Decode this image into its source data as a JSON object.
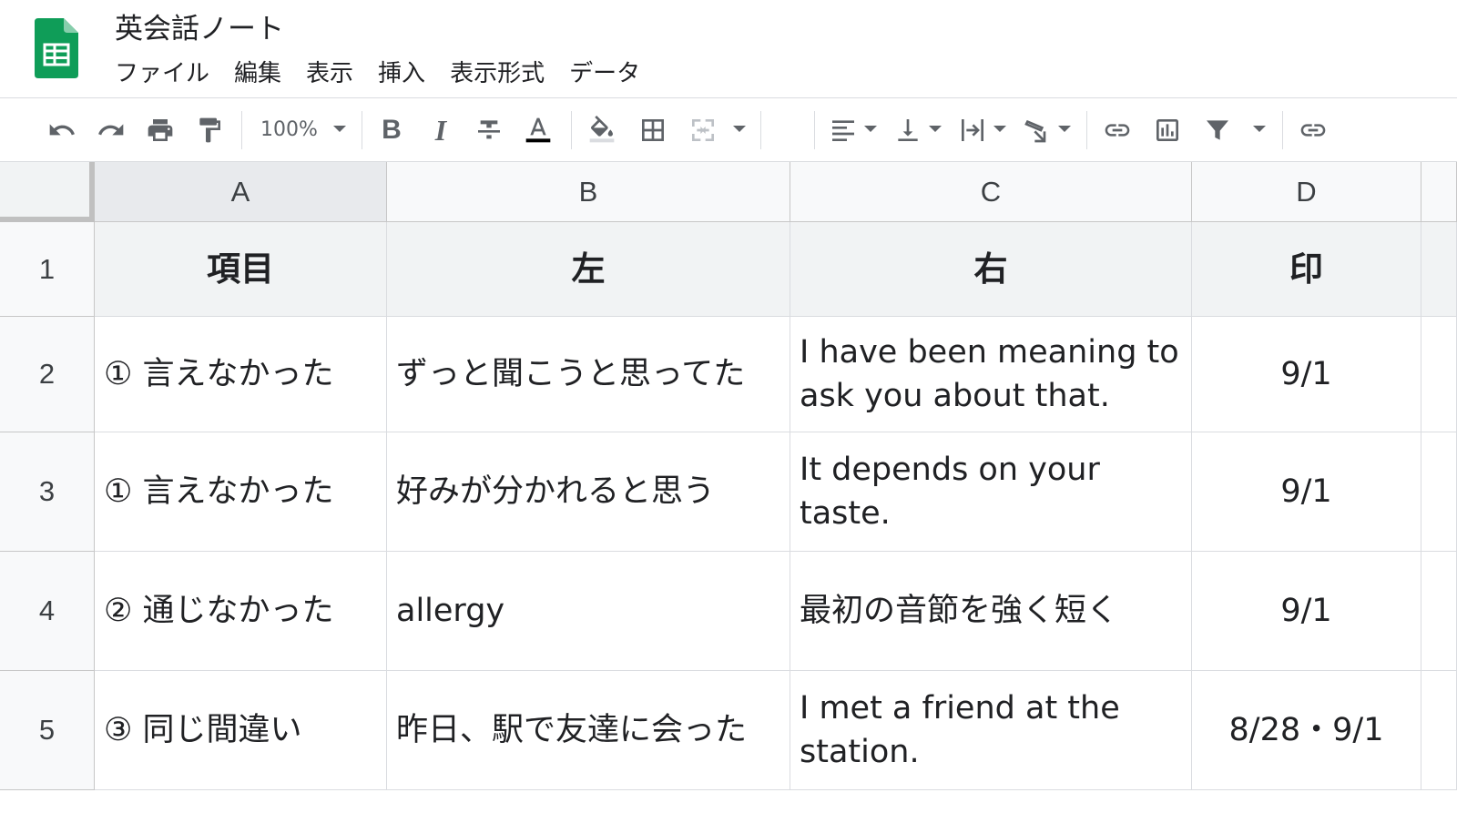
{
  "document": {
    "title": "英会話ノート"
  },
  "menu": [
    "ファイル",
    "編集",
    "表示",
    "挿入",
    "表示形式",
    "データ"
  ],
  "toolbar": {
    "zoom": "100%"
  },
  "colors": {
    "sheets_green": "#0f9d58",
    "header_bg": "#f1f3f4",
    "text": "#202124",
    "icon": "#5f6368"
  },
  "columns": [
    "A",
    "B",
    "C",
    "D"
  ],
  "rows": [
    "1",
    "2",
    "3",
    "4",
    "5"
  ],
  "table": {
    "header": {
      "a": "項目",
      "b": "左",
      "c": "右",
      "d": "印"
    },
    "data": [
      {
        "a": "① 言えなかった",
        "b": "ずっと聞こうと思ってた",
        "c": "I have been meaning to ask you about that.",
        "d": "9/1"
      },
      {
        "a": "① 言えなかった",
        "b": "好みが分かれると思う",
        "c": "It depends on your taste.",
        "d": "9/1"
      },
      {
        "a": "② 通じなかった",
        "b": "allergy",
        "c": "最初の音節を強く短く",
        "d": "9/1"
      },
      {
        "a": "③ 同じ間違い",
        "b": "昨日、駅で友達に会った",
        "c": "I met a friend at the station.",
        "d": "8/28・9/1"
      }
    ]
  }
}
